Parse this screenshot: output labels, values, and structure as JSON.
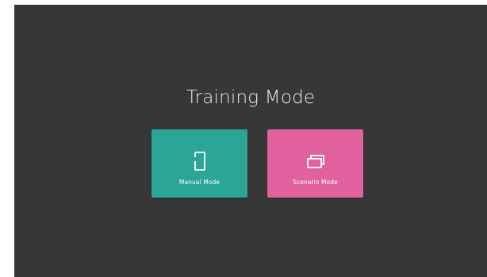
{
  "page": {
    "title": "Training Mode"
  },
  "cards": {
    "manual": {
      "label": "Manual Mode",
      "icon": "document-icon",
      "color": "#2aa596"
    },
    "scenario": {
      "label": "Scenario Mode",
      "icon": "stacked-windows-icon",
      "color": "#e0619d"
    }
  },
  "colors": {
    "background": "#373737",
    "title_text": "#e9e9e9"
  }
}
